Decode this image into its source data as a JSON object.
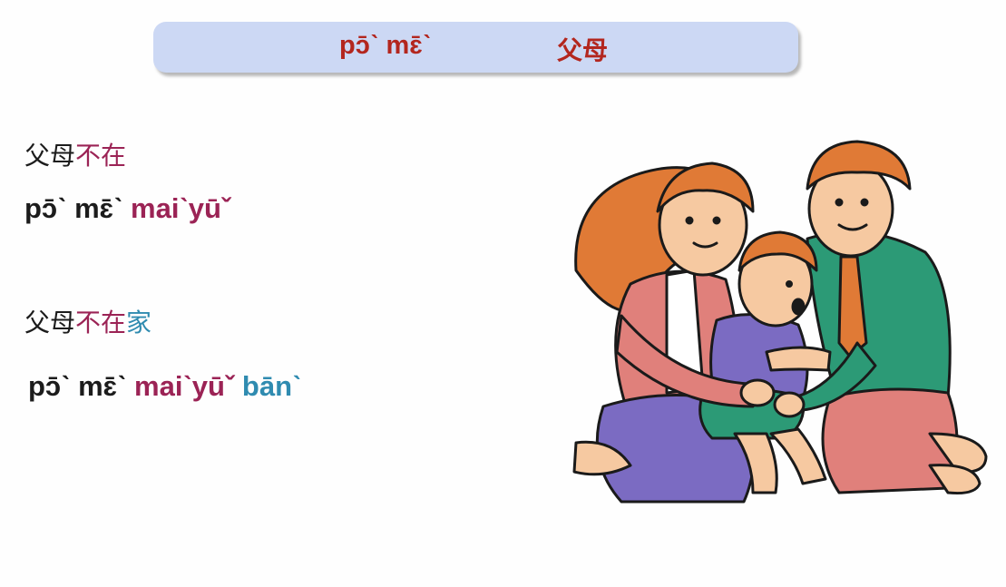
{
  "header": {
    "romanization": "pɔ̄ˋ mɛ̄ˋ",
    "hanzi": "父母"
  },
  "example1": {
    "hanzi": [
      {
        "text": "父母",
        "color": "#1c1c1c"
      },
      {
        "text": "不在",
        "color": "#9b2355"
      }
    ],
    "romanization": [
      {
        "text": "pɔ̄ˋ mɛ̄ˋ ",
        "color": "#1c1c1c"
      },
      {
        "text": "maiˋyūˇ",
        "color": "#9b2355"
      }
    ]
  },
  "example2": {
    "hanzi": [
      {
        "text": "父母",
        "color": "#1c1c1c"
      },
      {
        "text": "不在",
        "color": "#9b2355"
      },
      {
        "text": "家",
        "color": "#2f8bb0"
      }
    ],
    "romanization": [
      {
        "text": "pɔ̄ˋ mɛ̄ˋ ",
        "color": "#1c1c1c"
      },
      {
        "text": "maiˋyūˇ ",
        "color": "#9b2355"
      },
      {
        "text": "bānˋ",
        "color": "#2f8bb0"
      }
    ]
  },
  "illustration": {
    "icon": "family-hug-illustration"
  }
}
